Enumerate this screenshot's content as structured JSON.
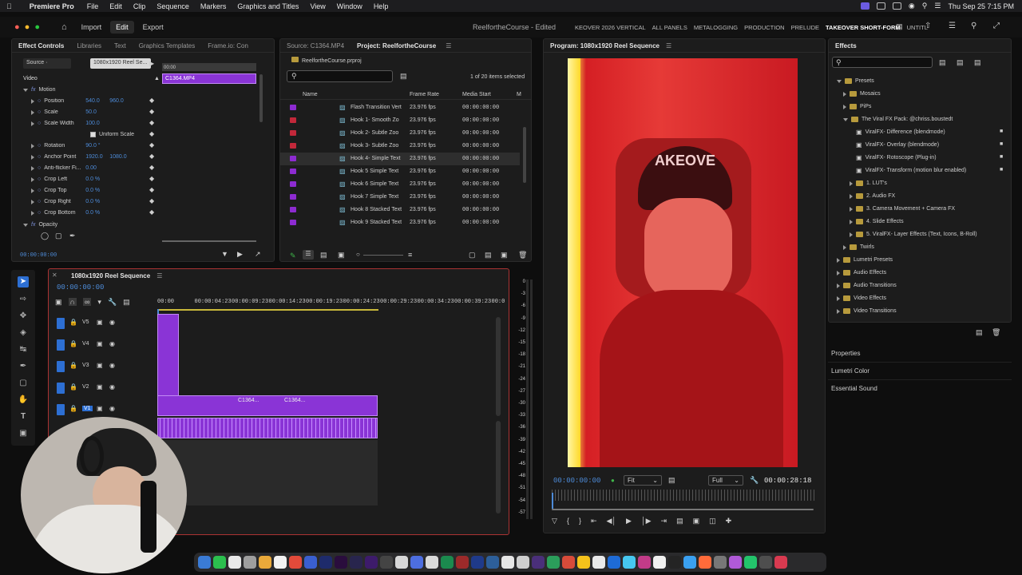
{
  "menubar": {
    "app": "Premiere Pro",
    "items": [
      "File",
      "Edit",
      "Clip",
      "Sequence",
      "Markers",
      "Graphics and Titles",
      "View",
      "Window",
      "Help"
    ],
    "datetime": "Thu Sep 25  7:15 PM"
  },
  "workspace": {
    "home_icon": "home-icon",
    "tabs": [
      "Import",
      "Edit",
      "Export"
    ],
    "active_tab": "Edit",
    "project_title": "ReelfortheCourse - Edited",
    "presets": [
      "KEOVER 2026 VERTICAL",
      "ALL PANELS",
      "METALOGGING",
      "PRODUCTION",
      "PRELUDE",
      "TAKEOVER SHORT-FORM",
      "UNTITL"
    ]
  },
  "effect_controls": {
    "tabs": [
      "Effect Controls",
      "Libraries",
      "Text",
      "Graphics Templates",
      "Frame.io: Con"
    ],
    "source_btn": "Source ·",
    "source_clip": "1080x1920 Reel Se...",
    "clip_name": "C1364.MP4",
    "clip_time": "00:00",
    "section_video": "Video",
    "motion": "Motion",
    "props": [
      {
        "name": "Position",
        "v1": "540.0",
        "v2": "960.0"
      },
      {
        "name": "Scale",
        "v1": "50.0",
        "v2": ""
      },
      {
        "name": "Scale Width",
        "v1": "100.0",
        "v2": ""
      },
      {
        "name": "Uniform Scale",
        "v1": "",
        "v2": ""
      },
      {
        "name": "Rotation",
        "v1": "90.0 °",
        "v2": ""
      },
      {
        "name": "Anchor Point",
        "v1": "1920.0",
        "v2": "1080.0"
      },
      {
        "name": "Anti-flicker Fi...",
        "v1": "0.00",
        "v2": ""
      },
      {
        "name": "Crop Left",
        "v1": "0.0 %",
        "v2": ""
      },
      {
        "name": "Crop Top",
        "v1": "0.0 %",
        "v2": ""
      },
      {
        "name": "Crop Right",
        "v1": "0.0 %",
        "v2": ""
      },
      {
        "name": "Crop Bottom",
        "v1": "0.0 %",
        "v2": ""
      }
    ],
    "opacity": "Opacity",
    "timecode": "00:00:00:00"
  },
  "project": {
    "tabs": [
      "Source: C1364.MP4",
      "Project: ReelfortheCourse"
    ],
    "file": "ReelfortheCourse.prproj",
    "search_placeholder": "",
    "selection": "1 of 20 items selected",
    "columns": [
      "Name",
      "Frame Rate",
      "Media Start",
      "M"
    ],
    "rows": [
      {
        "name": "Flash Transition Vert",
        "rate": "23.976 fps",
        "start": "00:00:00:00",
        "color": "#8d2bd1"
      },
      {
        "name": "Hook 1- Smooth Zo",
        "rate": "23.976 fps",
        "start": "00:00:00:00",
        "color": "#c2283a"
      },
      {
        "name": "Hook 2- Subtle Zoo",
        "rate": "23.976 fps",
        "start": "00:00:00:00",
        "color": "#c2283a"
      },
      {
        "name": "Hook 3- Subtle Zoo",
        "rate": "23.976 fps",
        "start": "00:00:00:00",
        "color": "#c2283a"
      },
      {
        "name": "Hook 4- Simple Text",
        "rate": "23.976 fps",
        "start": "00:00:00:00",
        "color": "#8d2bd1"
      },
      {
        "name": "Hook 5 Simple Text",
        "rate": "23.976 fps",
        "start": "00:00:00:00",
        "color": "#8d2bd1"
      },
      {
        "name": "Hook 6 Simple Text",
        "rate": "23.976 fps",
        "start": "00:00:00:00",
        "color": "#8d2bd1"
      },
      {
        "name": "Hook 7 Simple Text",
        "rate": "23.976 fps",
        "start": "00:00:00:00",
        "color": "#8d2bd1"
      },
      {
        "name": "Hook 8 Stacked Text",
        "rate": "23.976 fps",
        "start": "00:00:00:00",
        "color": "#8d2bd1"
      },
      {
        "name": "Hook 9 Stacked Text",
        "rate": "23.976 fps",
        "start": "00:00:00:00",
        "color": "#8d2bd1"
      }
    ]
  },
  "program": {
    "title": "Program: 1080x1920 Reel Sequence",
    "timecode": "00:00:00:00",
    "fit": "Fit",
    "quality": "Full",
    "duration": "00:00:28:18"
  },
  "timeline": {
    "title": "1080x1920 Reel Sequence",
    "timecode": "00:00:00:00",
    "ruler": [
      "00:00",
      "00:00:04:23",
      "00:00:09:23",
      "00:00:14:23",
      "00:00:19:23",
      "00:00:24:23",
      "00:00:29:23",
      "00:00:34:23",
      "00:00:39:23",
      "00:0"
    ],
    "tracks": [
      "V5",
      "V4",
      "V3",
      "V2",
      "V1"
    ],
    "clip_labels": [
      "C1364...",
      "C1364..."
    ],
    "meter_labels": [
      "0",
      "-3",
      "-6",
      "-9",
      "-12",
      "-15",
      "-18",
      "-21",
      "-24",
      "-27",
      "-30",
      "-33",
      "-36",
      "-39",
      "-42",
      "-45",
      "-48",
      "-51",
      "-54",
      "-57"
    ]
  },
  "effects": {
    "title": "Effects",
    "tree": [
      {
        "label": "Presets",
        "depth": 0,
        "open": true
      },
      {
        "label": "Mosaics",
        "depth": 1,
        "open": false
      },
      {
        "label": "PiPs",
        "depth": 1,
        "open": false
      },
      {
        "label": "The Viral FX Pack: @chriss.boustedt",
        "depth": 1,
        "open": true
      },
      {
        "label": "ViralFX- Difference (blendmode)",
        "depth": 2,
        "item": true
      },
      {
        "label": "ViralFX- Overlay (blendmode)",
        "depth": 2,
        "item": true
      },
      {
        "label": "ViralFX- Rotoscope (Plug-in)",
        "depth": 2,
        "item": true
      },
      {
        "label": "ViralFX- Transform (motion blur enabled)",
        "depth": 2,
        "item": true
      },
      {
        "label": "1. LUT's",
        "depth": 2,
        "open": false
      },
      {
        "label": "2. Audio FX",
        "depth": 2,
        "open": false
      },
      {
        "label": "3. Camera Movement + Camera FX",
        "depth": 2,
        "open": false
      },
      {
        "label": "4. Slide Effects",
        "depth": 2,
        "open": false
      },
      {
        "label": "5. ViralFX- Layer Effects (Text, Icons, B-Roll)",
        "depth": 2,
        "open": false
      },
      {
        "label": "Twirls",
        "depth": 1,
        "open": false
      },
      {
        "label": "Lumetri Presets",
        "depth": 0,
        "open": false
      },
      {
        "label": "Audio Effects",
        "depth": 0,
        "open": false
      },
      {
        "label": "Audio Transitions",
        "depth": 0,
        "open": false
      },
      {
        "label": "Video Effects",
        "depth": 0,
        "open": false
      },
      {
        "label": "Video Transitions",
        "depth": 0,
        "open": false
      }
    ],
    "bottom_panels": [
      "Properties",
      "Lumetri Color",
      "Essential Sound"
    ]
  },
  "colors": {
    "accent": "#4d8bd8",
    "clip_purple": "#8a34d6",
    "project_label": "#c2283a"
  }
}
